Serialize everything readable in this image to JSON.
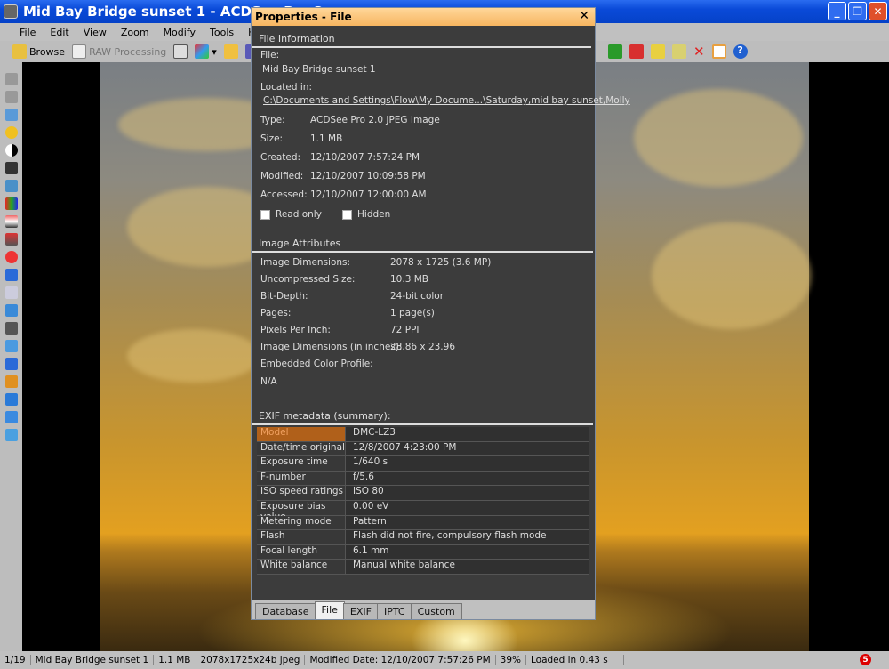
{
  "window": {
    "title": "Mid Bay Bridge sunset 1 - ACDSee Pro 2"
  },
  "menu": [
    "File",
    "Edit",
    "View",
    "Zoom",
    "Modify",
    "Tools",
    "Help"
  ],
  "toolbar": {
    "browse": "Browse",
    "raw_processing": "RAW Processing"
  },
  "dialog": {
    "title": "Properties - File",
    "file_info_header": "File Information",
    "file_label": "File:",
    "file_name": "Mid Bay Bridge sunset 1",
    "location_label": "Located in:",
    "location": "C:\\Documents and Settings\\Flow\\My Docume...\\Saturday,mid bay sunset,Molly",
    "fields": [
      {
        "label": "Type:",
        "value": "ACDSee Pro 2.0 JPEG Image"
      },
      {
        "label": "Size:",
        "value": "1.1 MB"
      },
      {
        "label": "Created:",
        "value": "12/10/2007 7:57:24 PM"
      },
      {
        "label": "Modified:",
        "value": "12/10/2007 10:09:58 PM"
      },
      {
        "label": "Accessed:",
        "value": "12/10/2007 12:00:00 AM"
      }
    ],
    "read_only": "Read only",
    "hidden": "Hidden",
    "image_attr_header": "Image Attributes",
    "attributes": [
      {
        "label": "Image Dimensions:",
        "value": "2078 x 1725 (3.6 MP)"
      },
      {
        "label": "Uncompressed Size:",
        "value": "10.3 MB"
      },
      {
        "label": "Bit-Depth:",
        "value": "24-bit color"
      },
      {
        "label": "Pages:",
        "value": "1 page(s)"
      },
      {
        "label": "Pixels Per Inch:",
        "value": "72 PPI"
      },
      {
        "label": "Image Dimensions (in inches):",
        "value": "28.86 x 23.96"
      },
      {
        "label": "Embedded Color Profile:",
        "value": ""
      }
    ],
    "color_profile_value": "N/A",
    "exif_header": "EXIF metadata (summary):",
    "exif": [
      {
        "key": "Model",
        "value": "DMC-LZ3"
      },
      {
        "key": "Date/time original",
        "value": "12/8/2007 4:23:00 PM"
      },
      {
        "key": "Exposure time",
        "value": "1/640 s"
      },
      {
        "key": "F-number",
        "value": "f/5.6"
      },
      {
        "key": "ISO speed ratings",
        "value": "ISO 80"
      },
      {
        "key": "Exposure bias value",
        "value": "0.00 eV"
      },
      {
        "key": "Metering mode",
        "value": "Pattern"
      },
      {
        "key": "Flash",
        "value": "Flash did not fire, compulsory flash mode"
      },
      {
        "key": "Focal length",
        "value": "6.1 mm"
      },
      {
        "key": "White balance",
        "value": "Manual white balance"
      }
    ],
    "tabs": [
      "Database",
      "File",
      "EXIF",
      "IPTC",
      "Custom"
    ],
    "active_tab": "File"
  },
  "status": [
    "1/19",
    "Mid Bay Bridge sunset 1",
    "1.1 MB",
    "2078x1725x24b jpeg",
    "Modified Date: 12/10/2007 7:57:26 PM",
    "39%",
    "Loaded in 0.43 s"
  ],
  "notification_count": "5"
}
